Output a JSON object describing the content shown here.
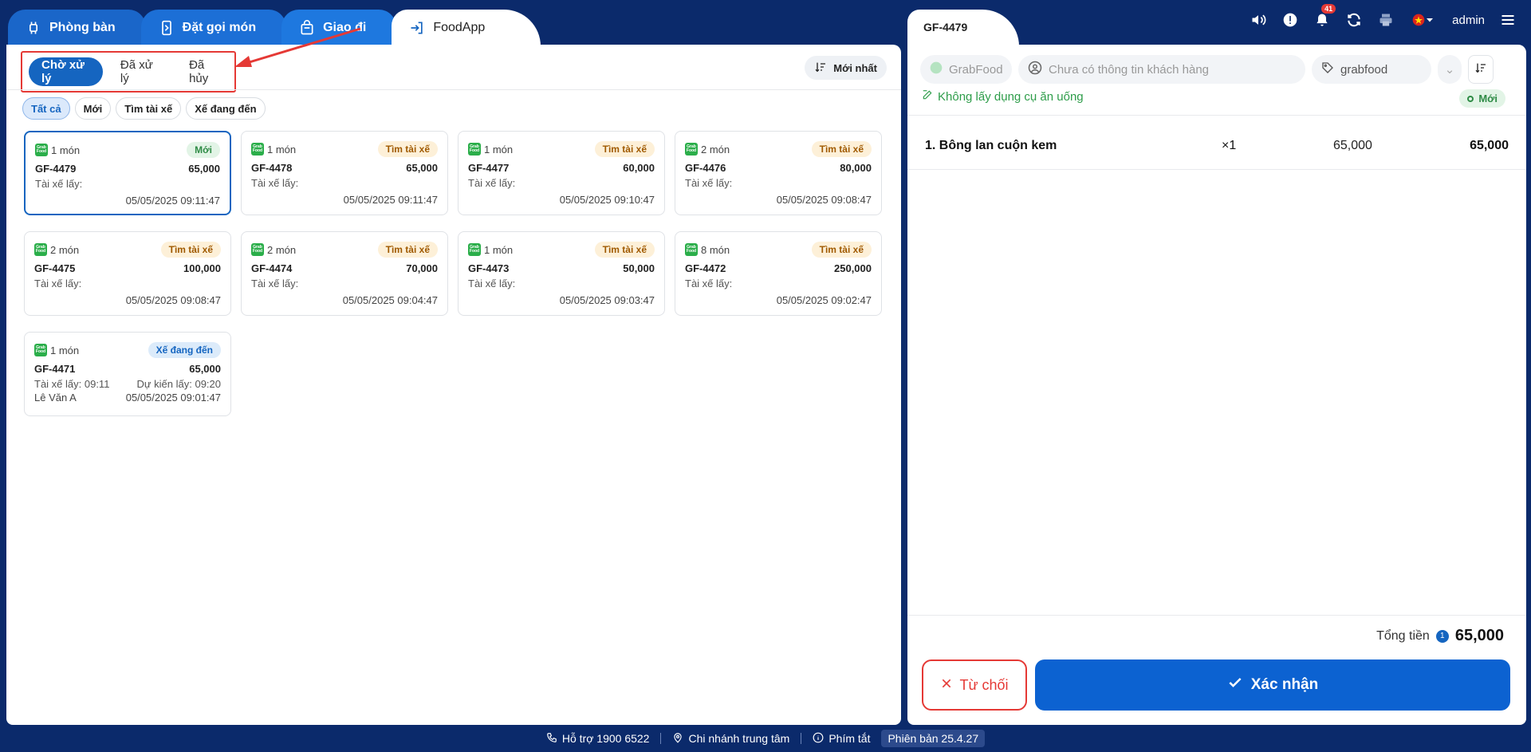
{
  "top_tabs": [
    {
      "label": "Phòng bàn",
      "icon": "table-icon",
      "active": false
    },
    {
      "label": "Đặt gọi món",
      "icon": "phone-order-icon",
      "active": false
    },
    {
      "label": "Giao đi",
      "icon": "bag-icon",
      "active": false
    },
    {
      "label": "FoodApp",
      "icon": "login-icon",
      "active": true
    }
  ],
  "status_tabs": [
    {
      "label": "Chờ xử lý",
      "active": true
    },
    {
      "label": "Đã xử lý",
      "active": false
    },
    {
      "label": "Đã hủy",
      "active": false
    }
  ],
  "sort_label": "Mới nhất",
  "filter_chips": [
    {
      "label": "Tất cả",
      "active": true
    },
    {
      "label": "Mới",
      "active": false
    },
    {
      "label": "Tìm tài xế",
      "active": false
    },
    {
      "label": "Xế đang đến",
      "active": false
    }
  ],
  "orders": [
    {
      "count": "1 món",
      "status": "Mới",
      "status_type": "new",
      "code": "GF-4479",
      "amount": "65,000",
      "driver": "Tài xế lấy:",
      "expected": "",
      "driver_name": "",
      "time": "05/05/2025 09:11:47",
      "selected": true
    },
    {
      "count": "1 món",
      "status": "Tìm tài xế",
      "status_type": "find",
      "code": "GF-4478",
      "amount": "65,000",
      "driver": "Tài xế lấy:",
      "expected": "",
      "driver_name": "",
      "time": "05/05/2025 09:11:47",
      "selected": false
    },
    {
      "count": "1 món",
      "status": "Tìm tài xế",
      "status_type": "find",
      "code": "GF-4477",
      "amount": "60,000",
      "driver": "Tài xế lấy:",
      "expected": "",
      "driver_name": "",
      "time": "05/05/2025 09:10:47",
      "selected": false
    },
    {
      "count": "2 món",
      "status": "Tìm tài xế",
      "status_type": "find",
      "code": "GF-4476",
      "amount": "80,000",
      "driver": "Tài xế lấy:",
      "expected": "",
      "driver_name": "",
      "time": "05/05/2025 09:08:47",
      "selected": false
    },
    {
      "count": "2 món",
      "status": "Tìm tài xế",
      "status_type": "find",
      "code": "GF-4475",
      "amount": "100,000",
      "driver": "Tài xế lấy:",
      "expected": "",
      "driver_name": "",
      "time": "05/05/2025 09:08:47",
      "selected": false
    },
    {
      "count": "2 món",
      "status": "Tìm tài xế",
      "status_type": "find",
      "code": "GF-4474",
      "amount": "70,000",
      "driver": "Tài xế lấy:",
      "expected": "",
      "driver_name": "",
      "time": "05/05/2025 09:04:47",
      "selected": false
    },
    {
      "count": "1 món",
      "status": "Tìm tài xế",
      "status_type": "find",
      "code": "GF-4473",
      "amount": "50,000",
      "driver": "Tài xế lấy:",
      "expected": "",
      "driver_name": "",
      "time": "05/05/2025 09:03:47",
      "selected": false
    },
    {
      "count": "8 món",
      "status": "Tìm tài xế",
      "status_type": "find",
      "code": "GF-4472",
      "amount": "250,000",
      "driver": "Tài xế lấy:",
      "expected": "",
      "driver_name": "",
      "time": "05/05/2025 09:02:47",
      "selected": false
    },
    {
      "count": "1 món",
      "status": "Xế đang đến",
      "status_type": "coming",
      "code": "GF-4471",
      "amount": "65,000",
      "driver": "Tài xế lấy: 09:11",
      "expected": "Dự kiến lấy: 09:20",
      "driver_name": "Lê Văn A",
      "time": "05/05/2025 09:01:47",
      "selected": false
    }
  ],
  "detail": {
    "order_code": "GF-4479",
    "source": "GrabFood",
    "customer_placeholder": "Chưa có thông tin khách hàng",
    "tag": "grabfood",
    "note": "Không lấy dụng cụ ăn uống",
    "status": "Mới",
    "items": [
      {
        "name": "1. Bông lan cuộn kem",
        "qty": "×1",
        "price": "65,000",
        "total": "65,000"
      }
    ],
    "total_label": "Tổng tiền",
    "total_count": "1",
    "total_value": "65,000",
    "reject_label": "Từ chối",
    "confirm_label": "Xác nhận"
  },
  "header": {
    "notification_count": "41",
    "user": "admin"
  },
  "footer": {
    "support": "Hỗ trợ 1900 6522",
    "branch": "Chi nhánh trung tâm",
    "shortcuts": "Phím tắt",
    "version": "Phiên bản 25.4.27"
  },
  "colors": {
    "background": "#0b2a6b",
    "primary": "#1565c0",
    "danger": "#e53935",
    "success": "#2e8b45",
    "warning": "#a05a00"
  }
}
